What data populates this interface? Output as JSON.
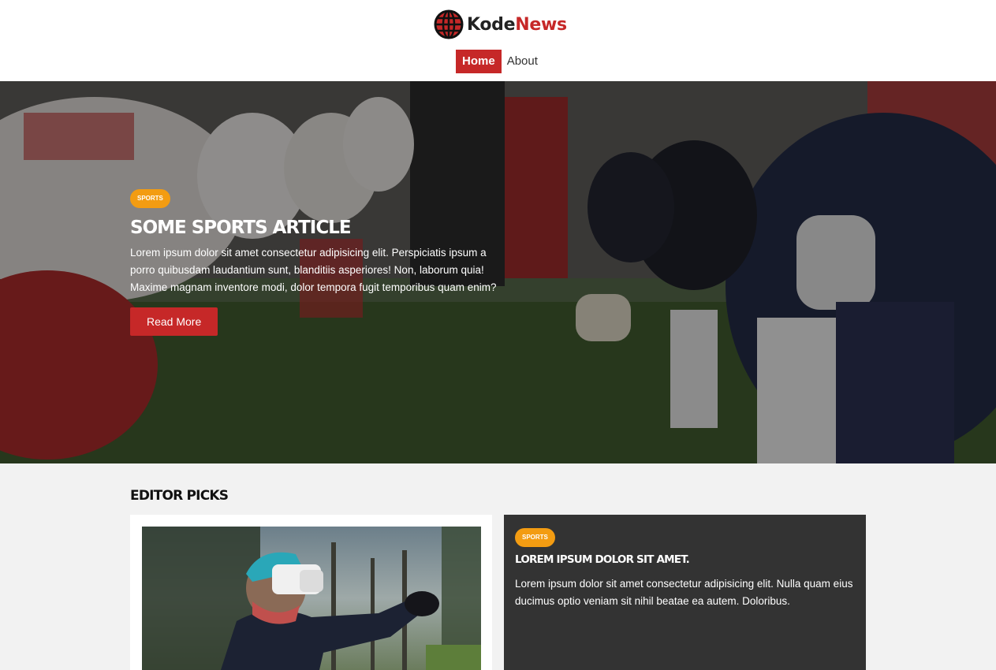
{
  "brand": {
    "name_part1": "Kode",
    "name_part2": "News",
    "accent_color": "#c62828"
  },
  "nav": {
    "items": [
      {
        "label": "Home",
        "active": true
      },
      {
        "label": "About",
        "active": false
      }
    ]
  },
  "hero": {
    "category": "Sports",
    "title": "Some Sports Article",
    "text": "Lorem ipsum dolor sit amet consectetur adipisicing elit. Perspiciatis ipsum a porro quibusdam laudantium sunt, blanditiis asperiores! Non, laborum quia! Maxime magnam inventore modi, dolor tempora fugit temporibus quam enim?",
    "button_label": "Read More",
    "badge_color": "#f39c12"
  },
  "editor_picks": {
    "title": "Editor Picks",
    "card": {
      "category": "Sports",
      "title": "Lorem ipsum dolor sit amet.",
      "text": "Lorem ipsum dolor sit amet consectetur adipisicing elit. Nulla quam eius ducimus optio veniam sit nihil beatae ea autem. Doloribus."
    }
  }
}
